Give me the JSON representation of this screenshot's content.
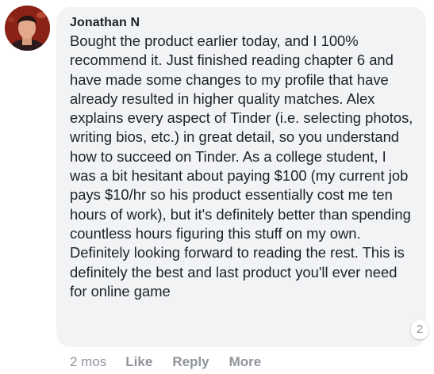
{
  "comment": {
    "author": "Jonathan N",
    "text": "Bought the product earlier today, and I 100% recommend it. Just finished reading chapter 6 and have made some changes to my profile that have already resulted in higher quality matches. Alex explains every aspect of Tinder (i.e. selecting photos, writing bios, etc.) in great detail, so you understand how to succeed on Tinder. As a college student, I was a bit hesitant about paying $100 (my current job pays $10/hr so his product essentially cost me ten hours of work), but it's definitely better than spending countless hours figuring this stuff on my own. Definitely looking forward to reading the rest. This is definitely the best and last product you'll ever need for online game",
    "reaction_count": "2",
    "timestamp": "2 mos",
    "actions": {
      "like": "Like",
      "reply": "Reply",
      "more": "More"
    }
  },
  "colors": {
    "bubble": "#f2f3f5",
    "text": "#1d2129",
    "muted": "#90949c"
  }
}
